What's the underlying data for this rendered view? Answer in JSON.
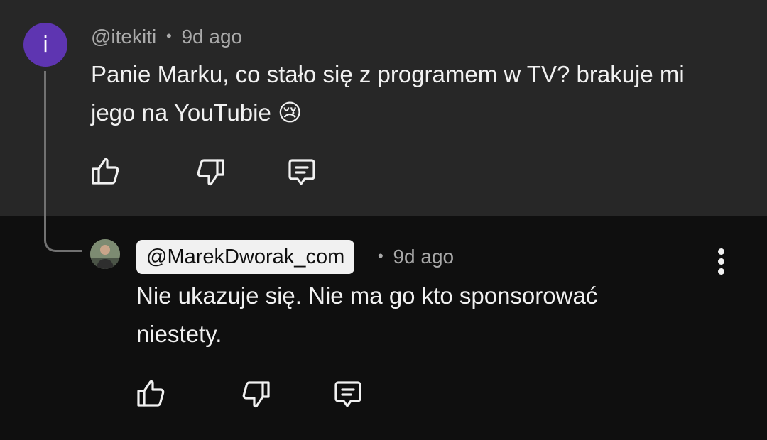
{
  "parent": {
    "avatar_initial": "i",
    "author": "@itekiti",
    "separator": "•",
    "age": "9d ago",
    "text": "Panie Marku, co stało się z programem w TV? brakuje mi jego na YouTubie 😢"
  },
  "reply": {
    "author": "@MarekDworak_com",
    "separator": "•",
    "age": "9d ago",
    "text": "Nie ukazuje się. Nie ma go kto sponsorować niestety."
  },
  "icons": {
    "like": "thumbs-up-icon",
    "dislike": "thumbs-down-icon",
    "reply": "comment-reply-icon",
    "more": "more-vertical-icon"
  },
  "colors": {
    "parent_bg": "#272727",
    "page_bg": "#0f0f0f",
    "avatar_bg": "#5e35b1",
    "text_primary": "#f1f1f1",
    "text_secondary": "#aaaaaa",
    "author_chip_bg": "#f1f1f1"
  }
}
